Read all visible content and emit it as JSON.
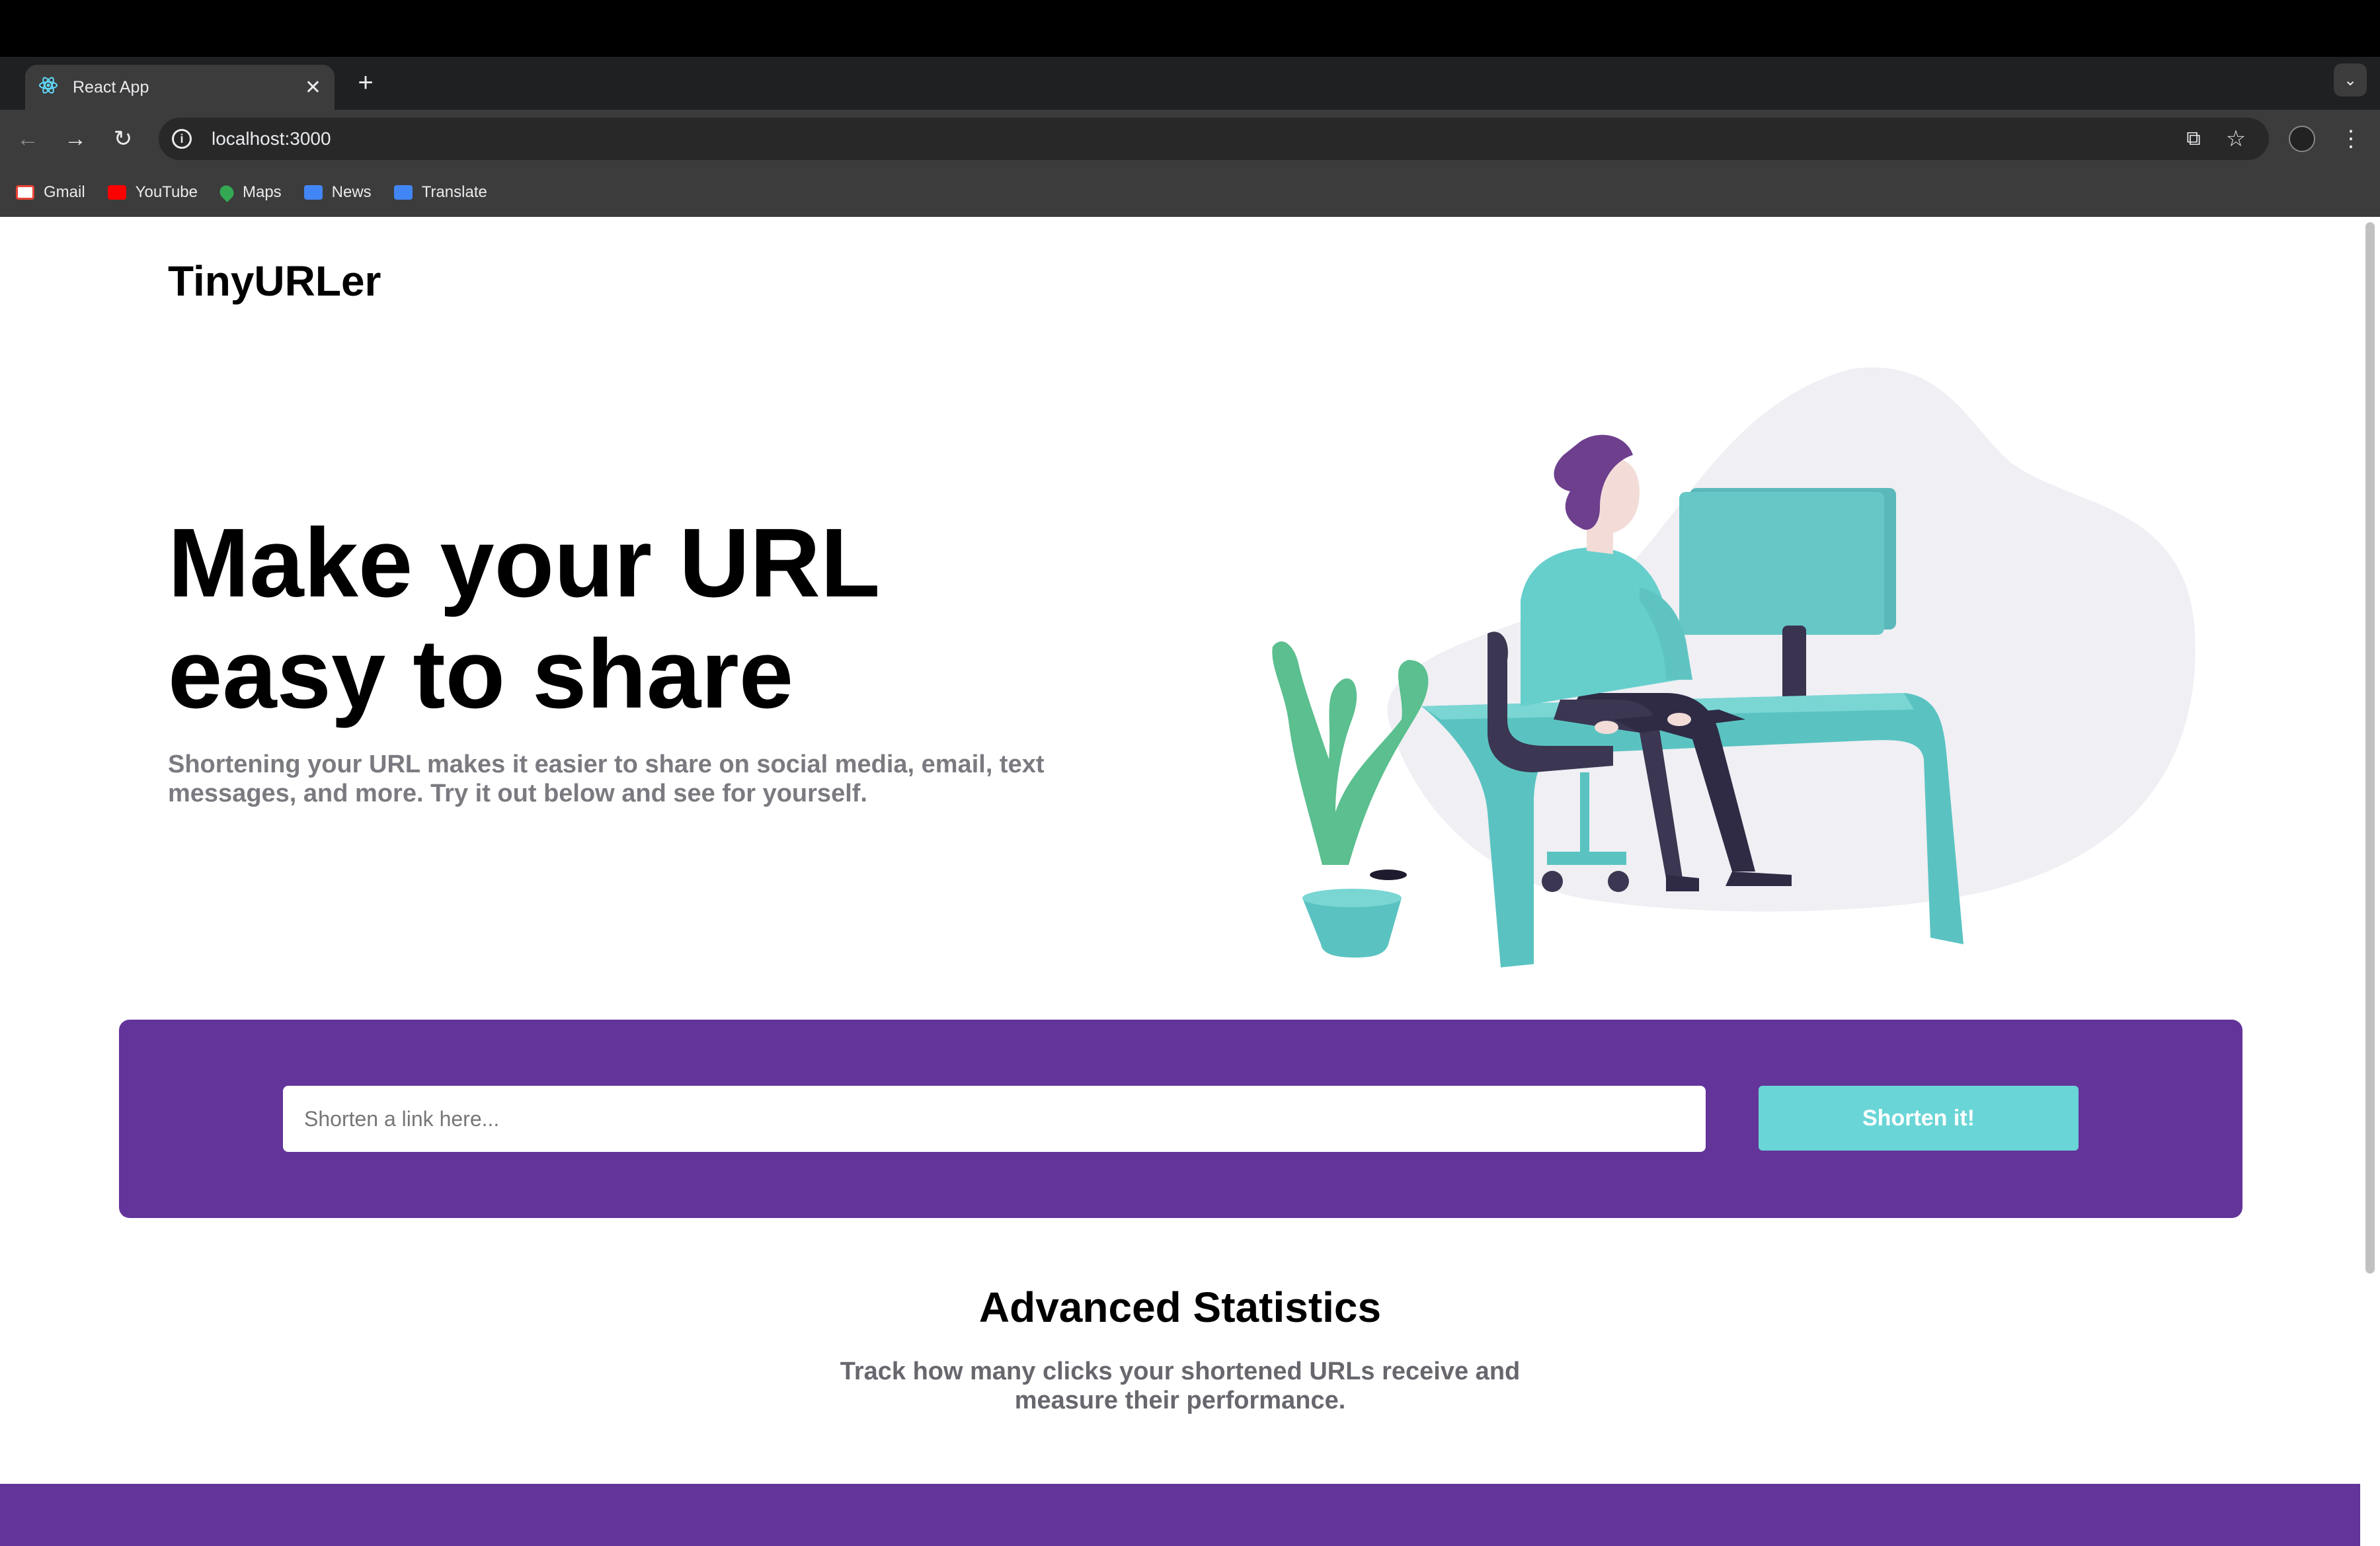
{
  "browser": {
    "tab_title": "React App",
    "url": "localhost:3000",
    "bookmarks": [
      "Gmail",
      "YouTube",
      "Maps",
      "News",
      "Translate"
    ]
  },
  "page": {
    "logo": "TinyURLer",
    "hero": {
      "title": "Make your URL easy to share",
      "text": "Shortening your URL makes it easier to share on social media, email, text messages, and more. Try it out below and see for yourself."
    },
    "shortener": {
      "placeholder": "Shorten a link here...",
      "button": "Shorten it!"
    },
    "stats": {
      "title": "Advanced Statistics",
      "text": "Track how many clicks your shortened URLs receive and measure their performance."
    }
  },
  "colors": {
    "brand_purple": "#63349a",
    "accent_cyan": "#6ad5d6"
  }
}
